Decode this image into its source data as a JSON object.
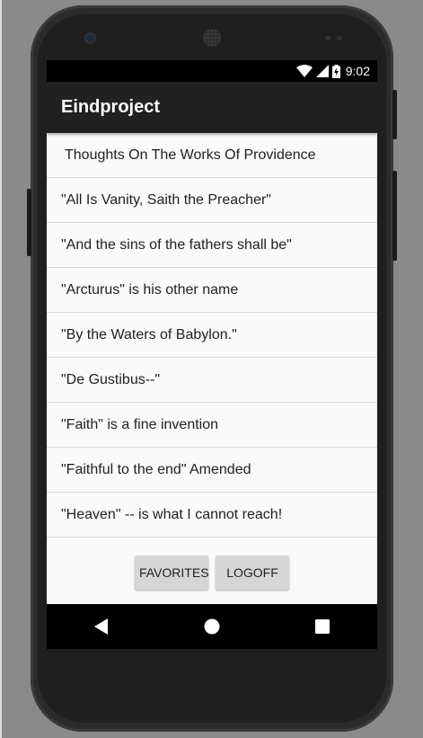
{
  "status": {
    "time": "9:02",
    "icons": [
      "wifi-icon",
      "signal-icon",
      "battery-charging-icon"
    ]
  },
  "appbar": {
    "title": "Eindproject"
  },
  "list": {
    "items": [
      "Thoughts On The Works Of Providence",
      "\"All Is Vanity, Saith the Preacher\"",
      "\"And the sins of the fathers shall be\"",
      "\"Arcturus\" is his other name",
      "\"By the Waters of Babylon.\"",
      "\"De Gustibus--\"",
      "\"Faith\" is a fine invention",
      "\"Faithful to the end\" Amended",
      "\"Heaven\" -- is what I cannot reach!"
    ]
  },
  "buttons": {
    "favorites_label": "FAVORITES",
    "logoff_label": "LOGOFF"
  },
  "navbar": {
    "icons": [
      "back-icon",
      "home-icon",
      "recents-icon"
    ]
  }
}
